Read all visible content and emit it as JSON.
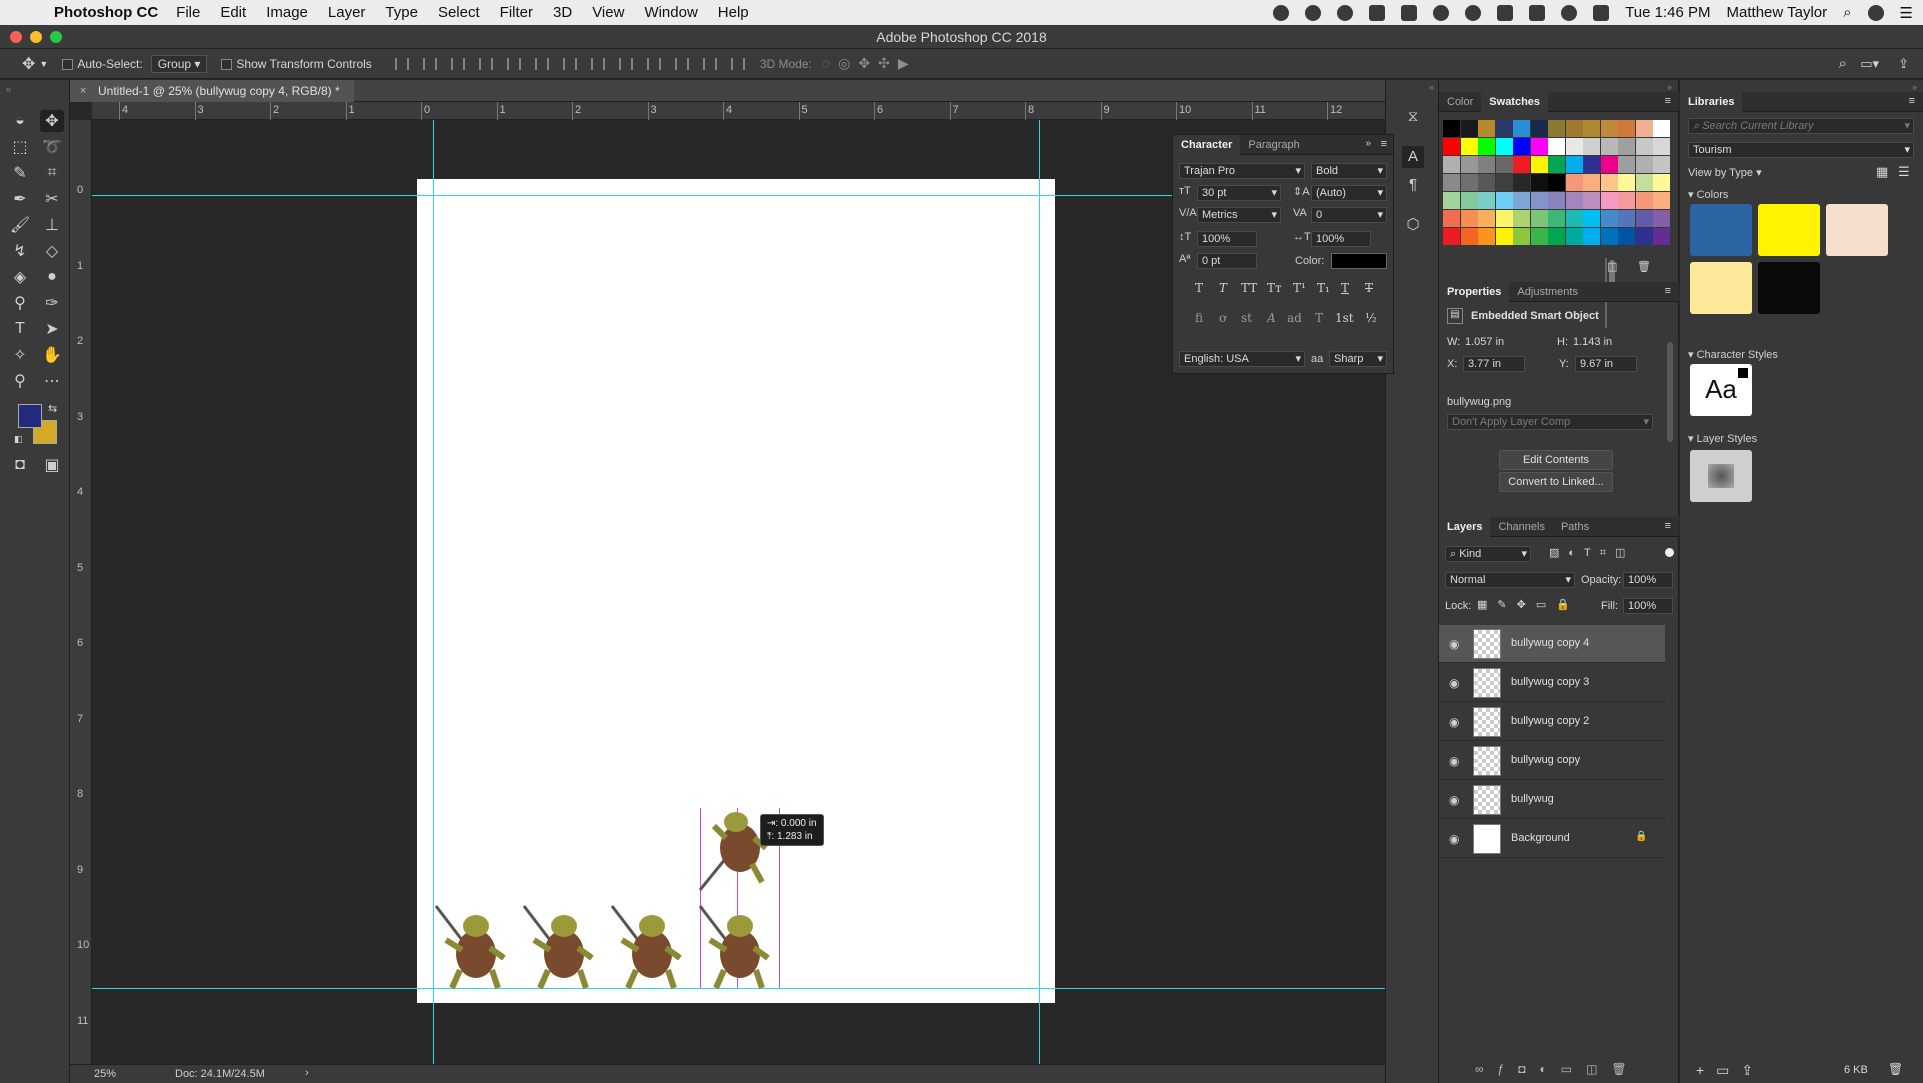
{
  "menubar": {
    "app_name": "Photoshop CC",
    "items": [
      "File",
      "Edit",
      "Image",
      "Layer",
      "Type",
      "Select",
      "Filter",
      "3D",
      "View",
      "Window",
      "Help"
    ],
    "clock": "Tue 1:46 PM",
    "user": "Matthew Taylor"
  },
  "window": {
    "title": "Adobe Photoshop CC 2018"
  },
  "options": {
    "auto_select_label": "Auto-Select:",
    "auto_select_value": "Group",
    "transform_controls_label": "Show Transform Controls",
    "mode_3d_label": "3D Mode:"
  },
  "document": {
    "tab_title": "Untitled-1 @ 25% (bullywug copy 4, RGB/8) *",
    "zoom": "25%",
    "doc_size": "Doc: 24.1M/24.5M"
  },
  "rulers": {
    "h_labels": [
      "4",
      "3",
      "2",
      "1",
      "0",
      "1",
      "2",
      "3",
      "4",
      "5",
      "6",
      "7",
      "8",
      "9",
      "10",
      "11",
      "12"
    ],
    "v_labels": [
      "0",
      "1",
      "2",
      "3",
      "4",
      "5",
      "6",
      "7",
      "8",
      "9",
      "10",
      "11"
    ]
  },
  "tooltip": {
    "line1": "⇥: 0.000 in",
    "line2": "⤒: 1.283 in"
  },
  "character": {
    "tabs": [
      "Character",
      "Paragraph"
    ],
    "font_family": "Trajan Pro",
    "font_style": "Bold",
    "font_size": "30 pt",
    "leading": "(Auto)",
    "kerning": "Metrics",
    "tracking": "0",
    "vscale": "100%",
    "hscale": "100%",
    "baseline": "0 pt",
    "color_label": "Color:",
    "language": "English: USA",
    "antialias_icon": "aa",
    "antialias": "Sharp",
    "format_buttons": [
      "T",
      "T",
      "TT",
      "Tт",
      "T¹",
      "T₁",
      "T",
      "T"
    ],
    "opentype_buttons": [
      "ﬁ",
      "ơ",
      "st",
      "A",
      "ad",
      "T",
      "1st",
      "½"
    ]
  },
  "swatches": {
    "tabs": [
      "Color",
      "Swatches"
    ],
    "rows": [
      [
        "#000000",
        "#1a1a1a",
        "#b48a2a",
        "#2a3a6a",
        "#2a8fd6",
        "#1a2a4a",
        "#8a7a30",
        "#a07830",
        "#b08830",
        "#c08838",
        "#d07838",
        "#f0b090",
        "#ffffff"
      ],
      [
        "#ff0000",
        "#ffff00",
        "#00ff00",
        "#00ffff",
        "#0000ff",
        "#ff00ff",
        "#ffffff",
        "#e8e8e8",
        "#d0d0d0",
        "#b8b8b8",
        "#a0a0a0",
        "#c8c8c8",
        "#d8d8d8"
      ],
      [
        "#b0b0b0",
        "#989898",
        "#808080",
        "#686868",
        "#ee1c24",
        "#fff200",
        "#00a651",
        "#00aeef",
        "#2e3192",
        "#ec008c",
        "#9e9e9e",
        "#b0b0b0",
        "#c4c4c4"
      ],
      [
        "#8a8a8a",
        "#707070",
        "#585858",
        "#404040",
        "#282828",
        "#101010",
        "#000000",
        "#f7977a",
        "#f9ad81",
        "#fdc68a",
        "#fff79a",
        "#c4df9b",
        "#fff79a"
      ],
      [
        "#a3d39c",
        "#82ca9d",
        "#7bcdc8",
        "#6ecff6",
        "#7ea7d8",
        "#8493ca",
        "#8882be",
        "#a187be",
        "#bc8dbf",
        "#f49ac2",
        "#f6989d",
        "#f7977a",
        "#f9ad81"
      ],
      [
        "#f26c4f",
        "#f68e55",
        "#fbaf5c",
        "#fff467",
        "#acd372",
        "#7cc576",
        "#3bb878",
        "#1abbb4",
        "#00bff3",
        "#438ccb",
        "#5574b9",
        "#605ca8",
        "#855fa8"
      ],
      [
        "#ed1c24",
        "#f26522",
        "#f7941d",
        "#fff200",
        "#8dc63f",
        "#39b54a",
        "#00a651",
        "#00a99d",
        "#00aeef",
        "#0072bc",
        "#0054a6",
        "#2e3192",
        "#662d91"
      ]
    ]
  },
  "properties": {
    "tabs": [
      "Properties",
      "Adjustments"
    ],
    "type": "Embedded Smart Object",
    "w_label": "W:",
    "w": "1.057 in",
    "h_label": "H:",
    "h": "1.143 in",
    "x_label": "X:",
    "x": "3.77 in",
    "y_label": "Y:",
    "y": "9.67 in",
    "file": "bullywug.png",
    "layer_comp": "Don't Apply Layer Comp",
    "edit_contents": "Edit Contents",
    "convert_linked": "Convert to Linked..."
  },
  "layers_panel": {
    "tabs": [
      "Layers",
      "Channels",
      "Paths"
    ],
    "filter": "Kind",
    "blend_mode": "Normal",
    "opacity_label": "Opacity:",
    "opacity": "100%",
    "lock_label": "Lock:",
    "fill_label": "Fill:",
    "fill": "100%",
    "layers": [
      {
        "name": "bullywug copy 4",
        "selected": true
      },
      {
        "name": "bullywug copy 3",
        "selected": false
      },
      {
        "name": "bullywug copy 2",
        "selected": false
      },
      {
        "name": "bullywug copy",
        "selected": false
      },
      {
        "name": "bullywug",
        "selected": false
      },
      {
        "name": "Background",
        "selected": false
      }
    ]
  },
  "libraries": {
    "title": "Libraries",
    "search_placeholder": "Search Current Library",
    "library": "Tourism",
    "view_by": "View by Type",
    "colors_title": "Colors",
    "colors": [
      "#2c64a4",
      "#fff400",
      "#f5dfcc",
      "#fde99a",
      "#0a0a0a"
    ],
    "char_styles_title": "Character Styles",
    "char_style_sample": "Aa",
    "layer_styles_title": "Layer Styles",
    "footer_size": "6 KB"
  },
  "colors": {
    "foreground": "#232b7c",
    "background": "#d3a928",
    "guide": "#2fd6e8"
  }
}
